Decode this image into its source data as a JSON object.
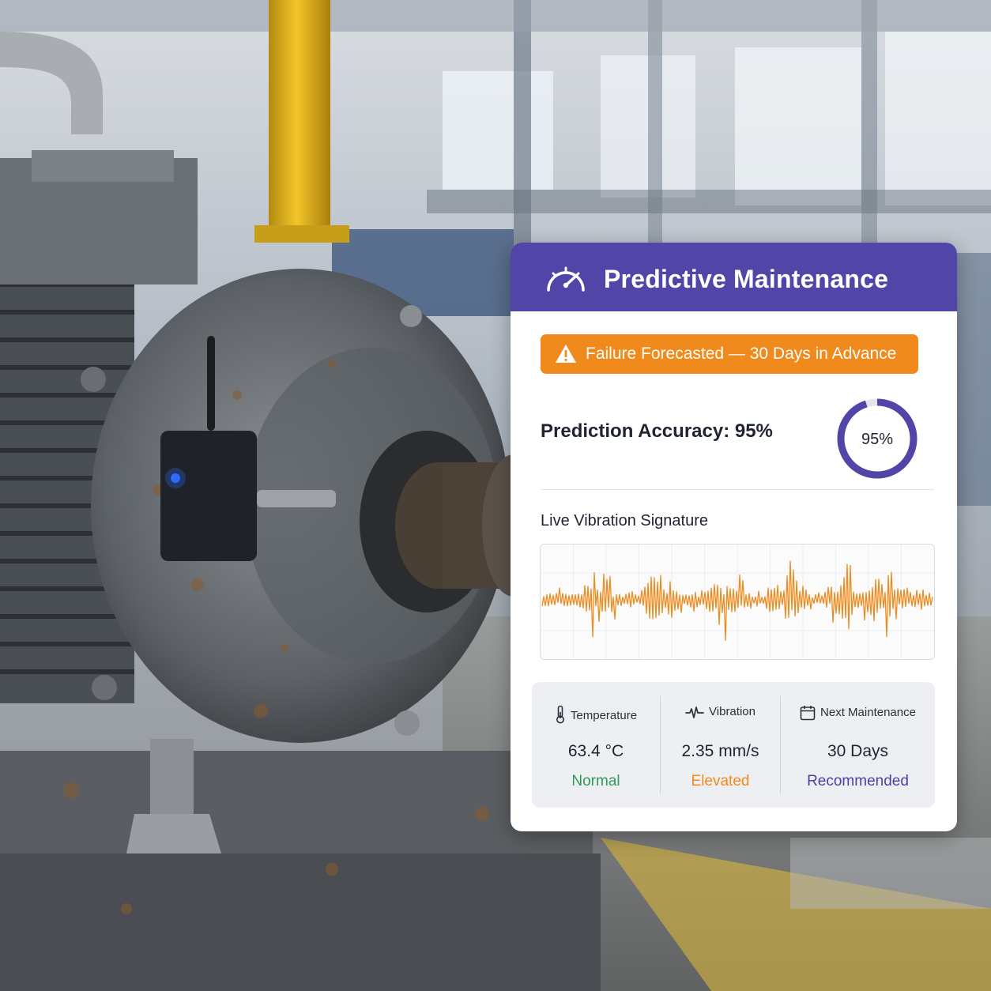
{
  "colors": {
    "header": "#5145a8",
    "alert": "#f08a1c",
    "donut_track": "#e6e6ea",
    "donut_fill": "#5145a8",
    "waveform": "#f08a1c",
    "status_normal": "#2f9a5a",
    "status_elevated": "#f08a1c",
    "status_recommended": "#4b3fa3"
  },
  "panel": {
    "title": "Predictive Maintenance",
    "header_icon": "speedometer-icon"
  },
  "alert": {
    "icon": "warning-triangle-icon",
    "text": "Failure Forecasted — 30 Days in Advance"
  },
  "accuracy": {
    "label": "Prediction Accuracy: 95%",
    "donut_text": "95%",
    "value": 0.95
  },
  "vibration_chart": {
    "title": "Live Vibration Signature"
  },
  "metrics": [
    {
      "icon": "thermometer-icon",
      "label": "Temperature",
      "value": "63.4 °C",
      "status": "Normal",
      "status_color": "#2f9a5a"
    },
    {
      "icon": "pulse-icon",
      "label": "Vibration",
      "value": "2.35 mm/s",
      "status": "Elevated",
      "status_color": "#f08a1c"
    },
    {
      "icon": "calendar-icon",
      "label": "Next Maintenance",
      "value": "30 Days",
      "status": "Recommended",
      "status_color": "#4b3fa3"
    }
  ]
}
